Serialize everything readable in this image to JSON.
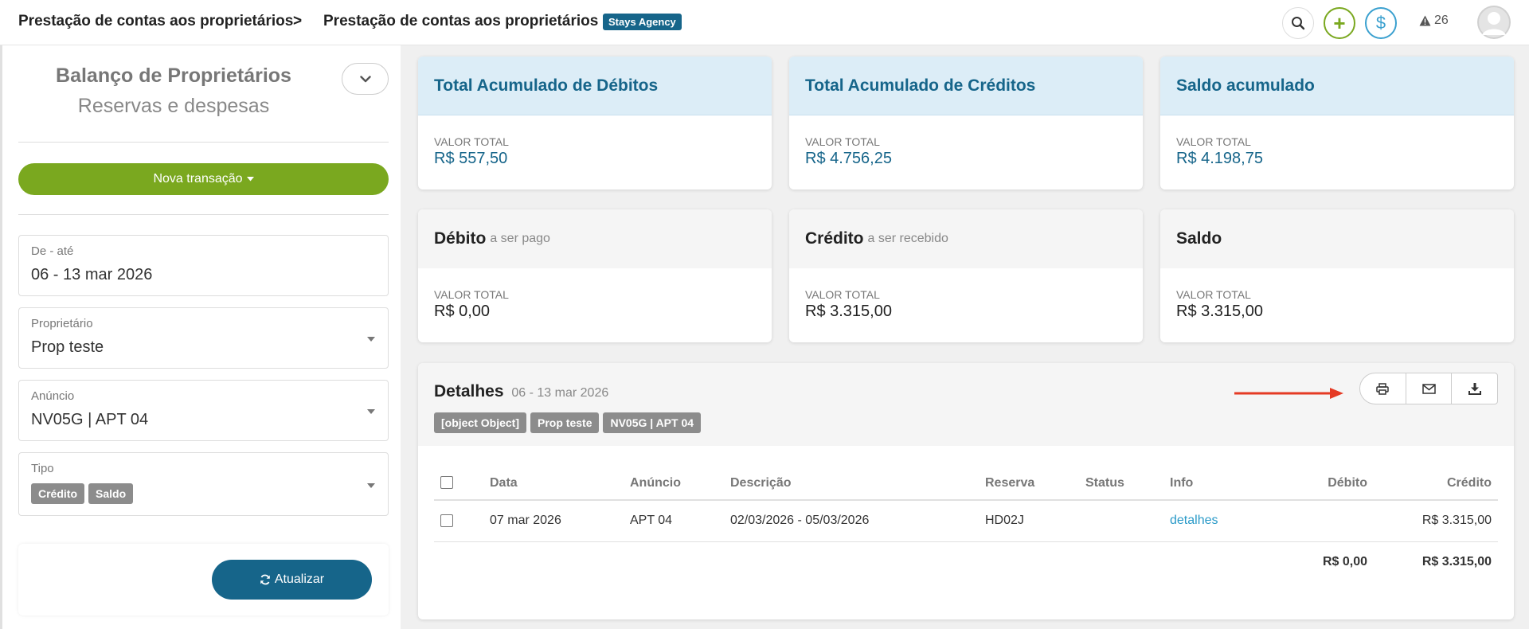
{
  "header": {
    "breadcrumb_1": "Prestação de contas aos proprietários",
    "breadcrumb_sep": ">",
    "breadcrumb_2": "Prestação de contas aos proprietários",
    "agency_badge": "Stays Agency",
    "add_symbol": "+",
    "money_symbol": "$",
    "alerts_count": "26"
  },
  "sidebar": {
    "title": "Balanço de Proprietários",
    "subtitle": "Reservas e despesas",
    "new_transaction_label": "Nova transação",
    "date_field": {
      "label": "De - até",
      "value": "06 - 13 mar 2026"
    },
    "owner_field": {
      "label": "Proprietário",
      "value": "Prop teste"
    },
    "listing_field": {
      "label": "Anúncio",
      "value": "NV05G | APT 04"
    },
    "type_field": {
      "label": "Tipo",
      "tags": [
        "Crédito",
        "Saldo"
      ]
    },
    "update_label": "Atualizar"
  },
  "cards": {
    "debits_total": {
      "title": "Total Acumulado de Débitos",
      "label": "VALOR TOTAL",
      "value": "R$ 557,50"
    },
    "credits_total": {
      "title": "Total Acumulado de Créditos",
      "label": "VALOR TOTAL",
      "value": "R$ 4.756,25"
    },
    "balance_total": {
      "title": "Saldo acumulado",
      "label": "VALOR TOTAL",
      "value": "R$ 4.198,75"
    },
    "debit": {
      "title": "Débito",
      "subtitle": "a ser pago",
      "label": "VALOR TOTAL",
      "value": "R$ 0,00"
    },
    "credit": {
      "title": "Crédito",
      "subtitle": "a ser recebido",
      "label": "VALOR TOTAL",
      "value": "R$ 3.315,00"
    },
    "balance": {
      "title": "Saldo",
      "label": "VALOR TOTAL",
      "value": "R$ 3.315,00"
    }
  },
  "details": {
    "title": "Detalhes",
    "range": "06 - 13 mar 2026",
    "tags": [
      "[object Object]",
      "Prop teste",
      "NV05G | APT 04"
    ],
    "columns": [
      "Data",
      "Anúncio",
      "Descrição",
      "Reserva",
      "Status",
      "Info",
      "Débito",
      "Crédito"
    ],
    "rows": [
      {
        "date": "07 mar 2026",
        "listing": "APT 04",
        "description": "02/03/2026 - 05/03/2026",
        "reservation": "HD02J",
        "status": "",
        "info": "detalhes",
        "debit": "",
        "credit": "R$ 3.315,00"
      }
    ],
    "totals": {
      "debit": "R$ 0,00",
      "credit": "R$ 3.315,00"
    }
  },
  "colors": {
    "brand_blue": "#16658a",
    "accent_green": "#7aa81f",
    "link_blue": "#2a9ac8",
    "arrow_red": "#e53a24"
  }
}
